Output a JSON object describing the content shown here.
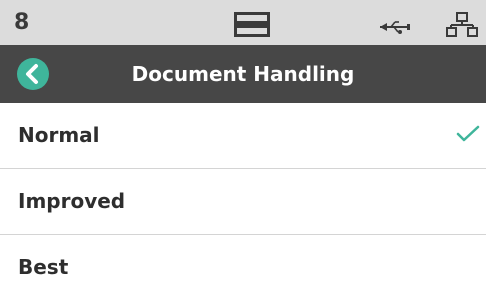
{
  "status_bar": {
    "number": "8",
    "icons": [
      "document-tray-icon",
      "usb-icon",
      "network-icon"
    ]
  },
  "header": {
    "title": "Document Handling",
    "back_icon": "chevron-left-icon"
  },
  "options": [
    {
      "label": "Normal",
      "selected": true
    },
    {
      "label": "Improved",
      "selected": false
    },
    {
      "label": "Best",
      "selected": false
    }
  ],
  "colors": {
    "accent": "#3fb59b",
    "title_bar": "#474747",
    "status_bar": "#dcdcdc"
  }
}
